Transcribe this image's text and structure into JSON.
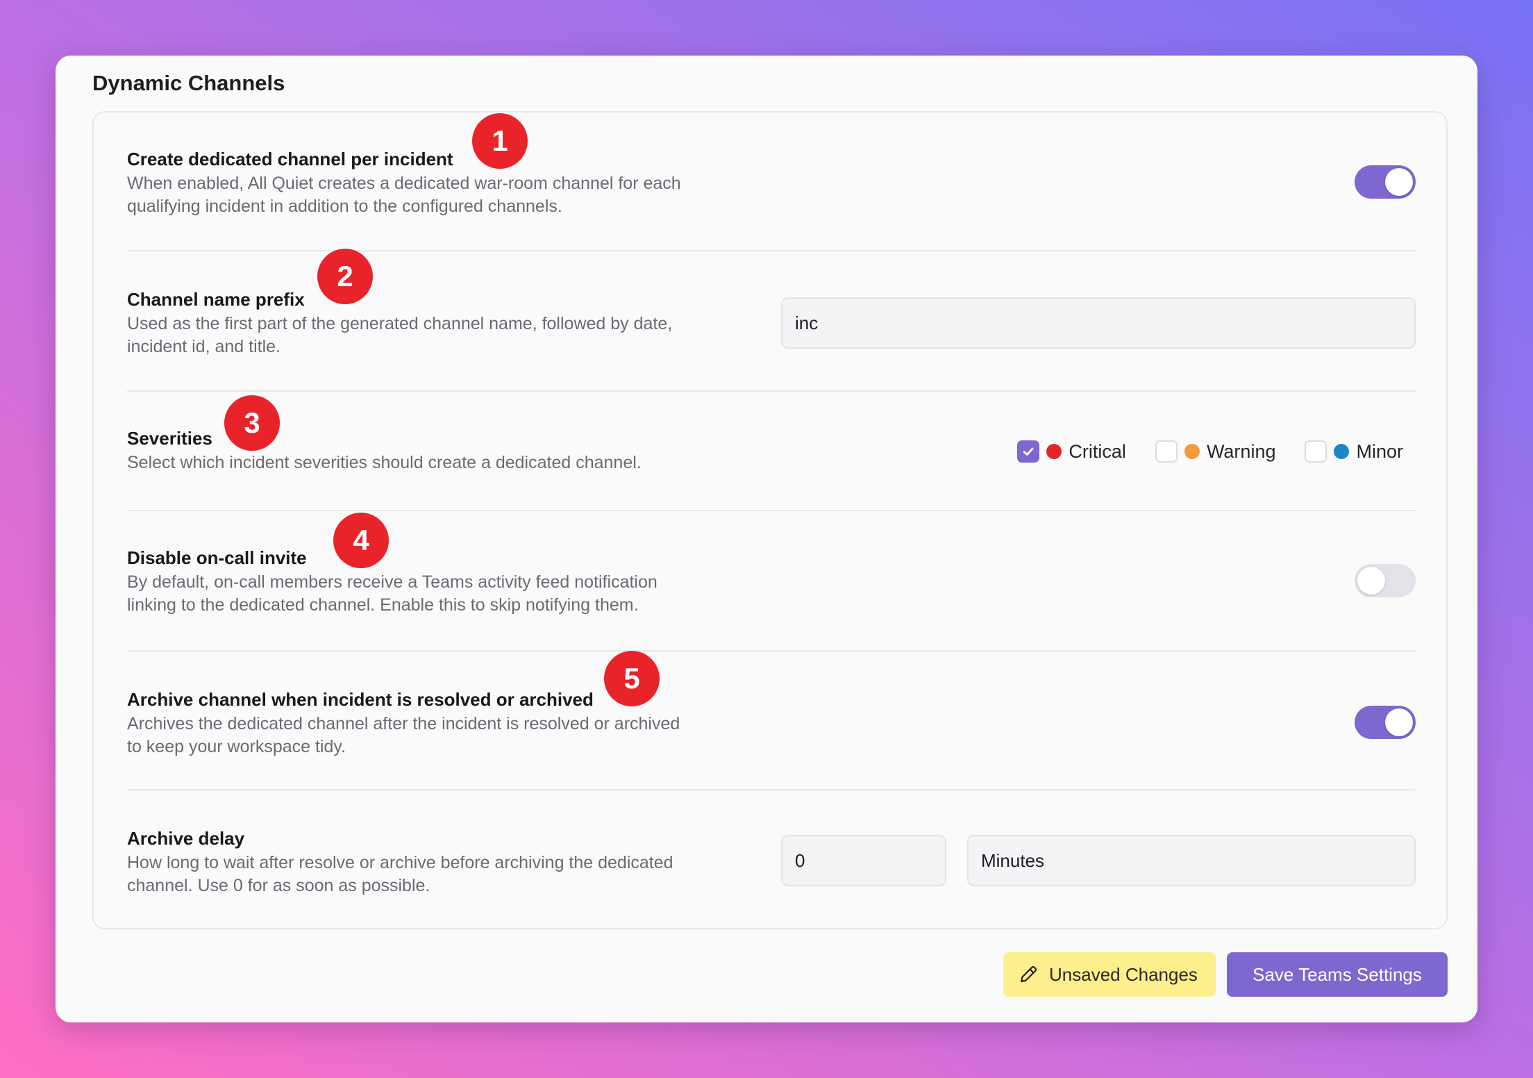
{
  "section_title": "Dynamic Channels",
  "rows": {
    "dedicated_channel": {
      "label": "Create dedicated channel per incident",
      "description_line1": "When enabled, All Quiet creates a dedicated war-room channel for each",
      "description_line2": "qualifying incident in addition to the configured channels.",
      "enabled": true
    },
    "prefix": {
      "label": "Channel name prefix",
      "description_line1": "Used as the first part of the generated channel name, followed by date,",
      "description_line2": "incident id, and title.",
      "value": "inc"
    },
    "severities": {
      "label": "Severities",
      "description": "Select which incident severities should create a dedicated channel.",
      "options": [
        {
          "label": "Critical",
          "checked": true,
          "color": "#e3262a"
        },
        {
          "label": "Warning",
          "checked": false,
          "color": "#f59a3a"
        },
        {
          "label": "Minor",
          "checked": false,
          "color": "#1a86c9"
        }
      ]
    },
    "oncall_invite": {
      "label": "Disable on-call invite",
      "description_line1": "By default, on-call members receive a Teams activity feed notification",
      "description_line2": "linking to the dedicated channel. Enable this to skip notifying them.",
      "enabled": false
    },
    "archive": {
      "label": "Archive channel when incident is resolved or archived",
      "description_line1": "Archives the dedicated channel after the incident is resolved or archived",
      "description_line2": "to keep your workspace tidy.",
      "enabled": true
    },
    "archive_delay": {
      "label": "Archive delay",
      "description_line1": "How long to wait after resolve or archive before archiving the dedicated",
      "description_line2": "channel. Use 0 for as soon as possible.",
      "value": "0",
      "unit": "Minutes"
    }
  },
  "badges": [
    "1",
    "2",
    "3",
    "4",
    "5"
  ],
  "footer": {
    "unsaved_label": "Unsaved Changes",
    "save_label": "Save Teams Settings"
  },
  "colors": {
    "accent": "#7e67cf",
    "badge": "#e8232a",
    "unsaved_bg": "#fdef8c"
  }
}
